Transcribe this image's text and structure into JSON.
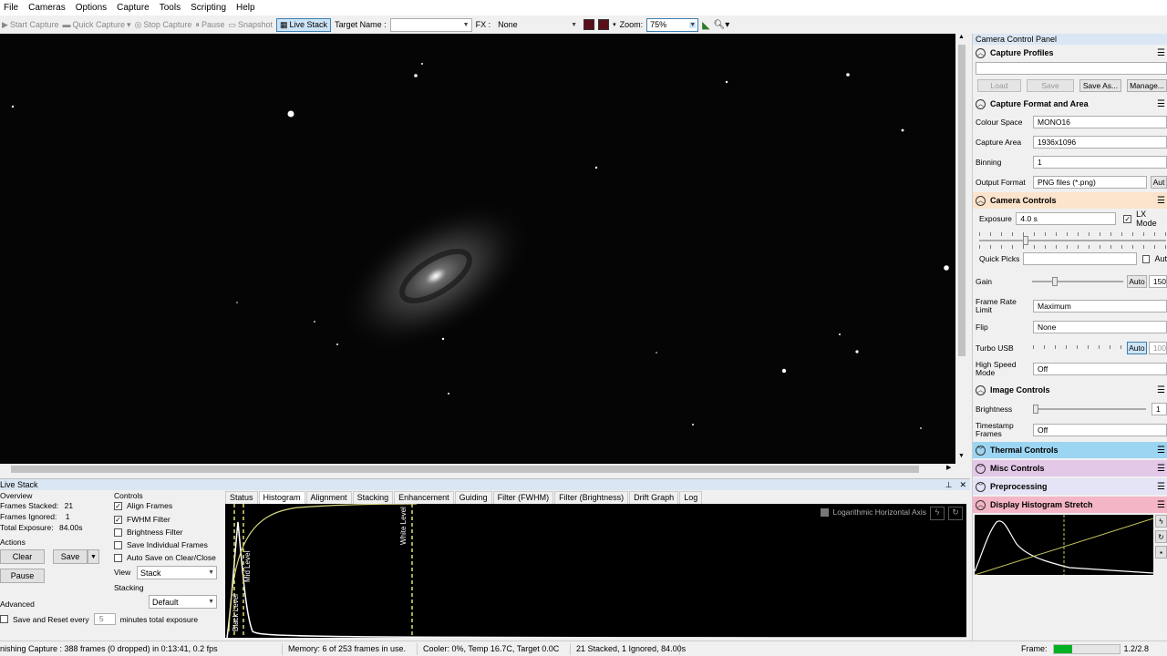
{
  "menu": [
    "File",
    "Cameras",
    "Options",
    "Capture",
    "Tools",
    "Scripting",
    "Help"
  ],
  "toolbar": {
    "start_capture": "Start Capture",
    "quick_capture": "Quick Capture",
    "stop_capture": "Stop Capture",
    "pause": "Pause",
    "snapshot": "Snapshot",
    "live_stack": "Live Stack",
    "target_label": "Target Name :",
    "target_value": "",
    "fx_label": "FX :",
    "fx_value": "None",
    "zoom_label": "Zoom:",
    "zoom_value": "75%"
  },
  "camera_panel": {
    "title": "Camera Control Panel",
    "capture_profiles": {
      "title": "Capture Profiles",
      "selected": "",
      "load": "Load",
      "save": "Save",
      "save_as": "Save As...",
      "manage": "Manage..."
    },
    "capture_format": {
      "title": "Capture Format and Area",
      "colour_space_label": "Colour Space",
      "colour_space": "MONO16",
      "capture_area_label": "Capture Area",
      "capture_area": "1936x1096",
      "binning_label": "Binning",
      "binning": "1",
      "output_format_label": "Output Format",
      "output_format": "PNG files (*.png)",
      "output_auto": "Aut"
    },
    "camera_controls": {
      "title": "Camera Controls",
      "exposure_label": "Exposure",
      "exposure": "4.0 s",
      "lx_mode": "LX Mode",
      "lx_checked": true,
      "quick_picks_label": "Quick Picks",
      "quick_picks_auto": "Aut",
      "gain_label": "Gain",
      "gain_auto": "Auto",
      "gain_value": "150",
      "frame_rate_label": "Frame Rate Limit",
      "frame_rate": "Maximum",
      "flip_label": "Flip",
      "flip": "None",
      "turbo_label": "Turbo USB",
      "turbo_auto": "Auto",
      "turbo_value": "100",
      "hsm_label": "High Speed Mode",
      "hsm": "Off"
    },
    "image_controls": {
      "title": "Image Controls",
      "brightness_label": "Brightness",
      "brightness_value": "1",
      "timestamp_label": "Timestamp Frames",
      "timestamp": "Off"
    },
    "thermal": {
      "title": "Thermal Controls",
      "color": "#9cd5f2"
    },
    "misc": {
      "title": "Misc Controls",
      "color": "#e3c8e8"
    },
    "preprocessing": {
      "title": "Preprocessing",
      "color": "#e4e4f6"
    },
    "histogram_stretch": {
      "title": "Display Histogram Stretch",
      "color": "#f4b6c6"
    }
  },
  "live_stack": {
    "title": "Live Stack",
    "overview_label": "Overview",
    "frames_stacked_label": "Frames Stacked:",
    "frames_stacked": "21",
    "frames_ignored_label": "Frames Ignored:",
    "frames_ignored": "1",
    "total_exposure_label": "Total Exposure:",
    "total_exposure": "84.00s",
    "actions_label": "Actions",
    "clear": "Clear",
    "save": "Save",
    "pause": "Pause",
    "advanced_label": "Advanced",
    "save_reset_label": "Save and Reset every",
    "save_reset_value": "5",
    "save_reset_suffix": "minutes total exposure",
    "controls_label": "Controls",
    "align_frames": "Align Frames",
    "fwhm_filter": "FWHM Filter",
    "brightness_filter": "Brightness Filter",
    "save_individual": "Save Individual Frames",
    "auto_save": "Auto Save on Clear/Close",
    "view_label": "View",
    "view": "Stack",
    "stacking_label": "Stacking",
    "stacking": "Default",
    "tabs": [
      "Status",
      "Histogram",
      "Alignment",
      "Stacking",
      "Enhancement",
      "Guiding",
      "Filter (FWHM)",
      "Filter (Brightness)",
      "Drift Graph",
      "Log"
    ],
    "active_tab": "Histogram",
    "log_axis_label": "Logarithmic Horizontal Axis",
    "mid_level": "Mid Level",
    "black_level": "Black Level",
    "white_level": "White Level"
  },
  "status": {
    "capture": "nishing Capture : 388 frames (0 dropped) in 0:13:41, 0.2 fps",
    "memory": "Memory: 6 of 253 frames in use.",
    "cooler": "Cooler: 0%, Temp 16.7C, Target 0.0C",
    "stack": "21 Stacked, 1 Ignored, 84.00s",
    "frame_label": "Frame:",
    "version": "1.2/2.8"
  }
}
